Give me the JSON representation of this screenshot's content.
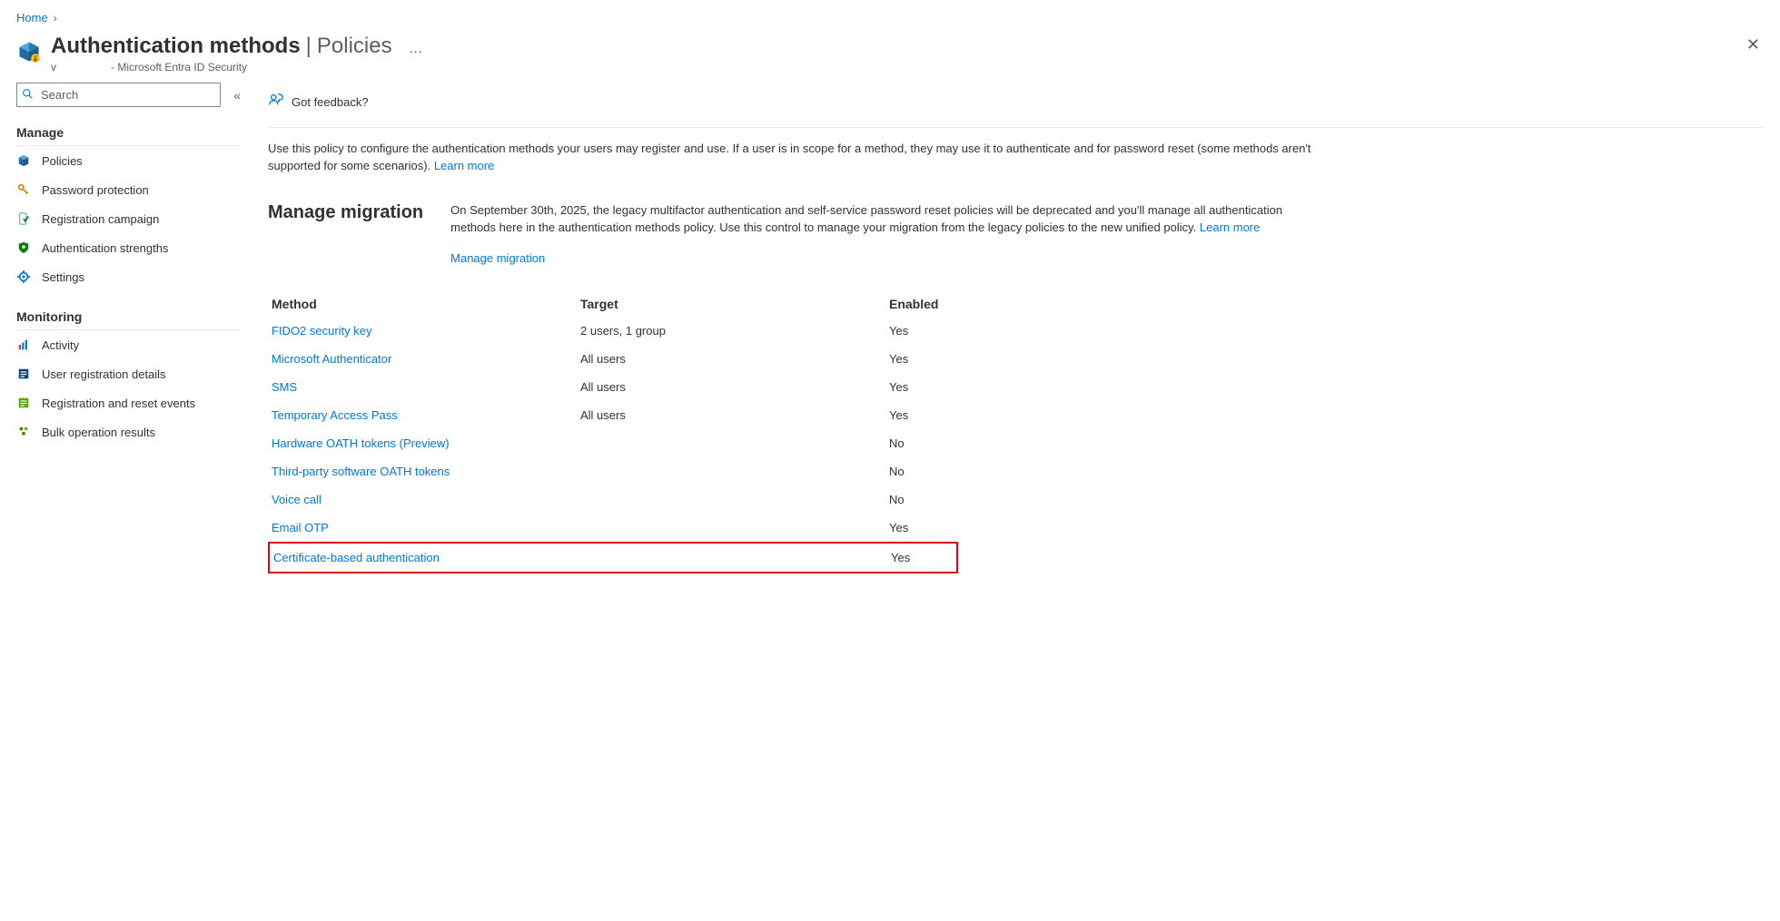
{
  "breadcrumb": {
    "home": "Home"
  },
  "header": {
    "title": "Authentication methods",
    "subtitle": "Policies",
    "more": "…",
    "meta_prefix": "v",
    "meta_suffix": "- Microsoft Entra ID Security"
  },
  "sidebar": {
    "search_placeholder": "Search",
    "sections": {
      "manage": "Manage",
      "monitoring": "Monitoring"
    },
    "manage_items": [
      {
        "label": "Policies"
      },
      {
        "label": "Password protection"
      },
      {
        "label": "Registration campaign"
      },
      {
        "label": "Authentication strengths"
      },
      {
        "label": "Settings"
      }
    ],
    "monitoring_items": [
      {
        "label": "Activity"
      },
      {
        "label": "User registration details"
      },
      {
        "label": "Registration and reset events"
      },
      {
        "label": "Bulk operation results"
      }
    ]
  },
  "toolbar": {
    "feedback": "Got feedback?"
  },
  "intro": {
    "text": "Use this policy to configure the authentication methods your users may register and use. If a user is in scope for a method, they may use it to authenticate and for password reset (some methods aren't supported for some scenarios). ",
    "learn_more": "Learn more"
  },
  "migration": {
    "title": "Manage migration",
    "body": "On September 30th, 2025, the legacy multifactor authentication and self-service password reset policies will be deprecated and you'll manage all authentication methods here in the authentication methods policy. Use this control to manage your migration from the legacy policies to the new unified policy. ",
    "learn_more": "Learn more",
    "link": "Manage migration"
  },
  "table": {
    "headers": {
      "method": "Method",
      "target": "Target",
      "enabled": "Enabled"
    },
    "rows": [
      {
        "method": "FIDO2 security key",
        "target": "2 users, 1 group",
        "enabled": "Yes"
      },
      {
        "method": "Microsoft Authenticator",
        "target": "All users",
        "enabled": "Yes"
      },
      {
        "method": "SMS",
        "target": "All users",
        "enabled": "Yes"
      },
      {
        "method": "Temporary Access Pass",
        "target": "All users",
        "enabled": "Yes"
      },
      {
        "method": "Hardware OATH tokens (Preview)",
        "target": "",
        "enabled": "No"
      },
      {
        "method": "Third-party software OATH tokens",
        "target": "",
        "enabled": "No"
      },
      {
        "method": "Voice call",
        "target": "",
        "enabled": "No"
      },
      {
        "method": "Email OTP",
        "target": "",
        "enabled": "Yes"
      },
      {
        "method": "Certificate-based authentication",
        "target": "",
        "enabled": "Yes",
        "highlight": true
      }
    ]
  }
}
